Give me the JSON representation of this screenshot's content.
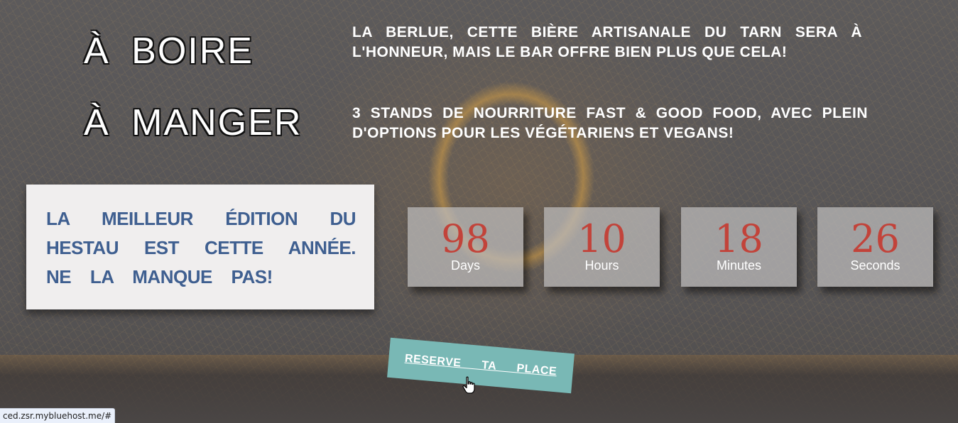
{
  "headings": {
    "drink": "À BOIRE",
    "eat": "À MANGER"
  },
  "descriptions": {
    "drink": "LA BERLUE, CETTE BIÈRE ARTISANALE DU TARN SERA À L'HONNEUR, MAIS LE BAR OFFRE BIEN PLUS QUE CELA!",
    "eat": "3 STANDS DE NOURRITURE FAST & GOOD FOOD, AVEC PLEIN D'OPTIONS POUR LES VÉGÉTARIENS ET VEGANS!"
  },
  "promo": {
    "text": "LA MEILLEUR ÉDITION DU HESTAU EST CETTE ANNÉE. NE LA MANQUE PAS!"
  },
  "countdown": {
    "days": {
      "value": "98",
      "label": "Days"
    },
    "hours": {
      "value": "10",
      "label": "Hours"
    },
    "minutes": {
      "value": "18",
      "label": "Minutes"
    },
    "seconds": {
      "value": "26",
      "label": "Seconds"
    }
  },
  "cta": {
    "label": "RESERVE TA PLACE"
  },
  "status_bar": {
    "url": "ced.zsr.mybluehost.me/#"
  },
  "colors": {
    "promo_text": "#3f5f90",
    "counter_number": "#c2433a",
    "cta_background": "#79b8b5"
  },
  "icons": {
    "cursor": "hand-pointer-icon"
  }
}
